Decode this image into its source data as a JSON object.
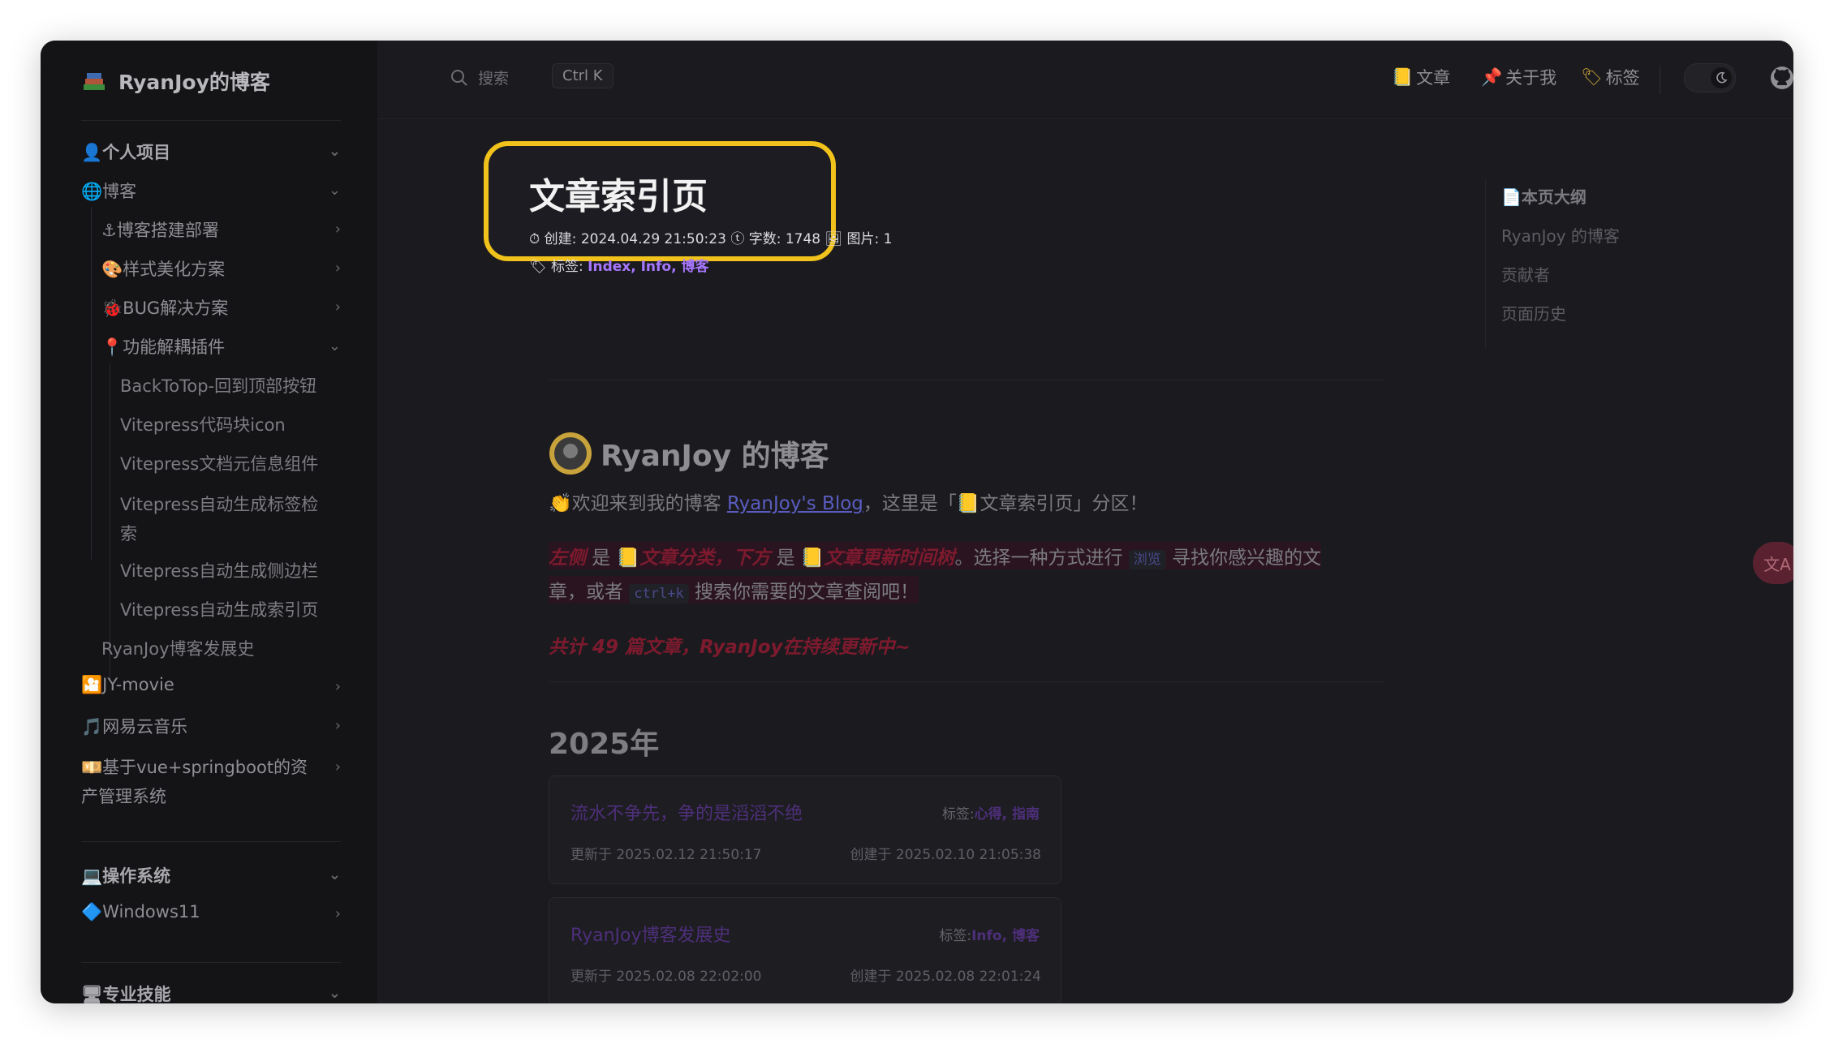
{
  "brand": {
    "title": "RyanJoy的博客"
  },
  "search": {
    "placeholder": "搜索",
    "shortcut": "Ctrl K"
  },
  "topnav": [
    {
      "label": "文章",
      "icon": "notebook-icon"
    },
    {
      "label": "关于我",
      "icon": "pin-icon"
    },
    {
      "label": "标签",
      "icon": "tag-icon"
    }
  ],
  "sidebar": {
    "sections": [
      {
        "label": "个人项目",
        "icon": "person-icon"
      },
      {
        "label": "博客",
        "icon": "globe-icon"
      },
      {
        "label": "博客搭建部署",
        "icon": "anchor-icon"
      },
      {
        "label": "样式美化方案",
        "icon": "palette-icon"
      },
      {
        "label": "BUG解决方案",
        "icon": "bug-icon"
      },
      {
        "label": "功能解耦插件",
        "icon": "pin-icon"
      },
      {
        "label": "BackToTop-回到顶部按钮"
      },
      {
        "label": "Vitepress代码块icon"
      },
      {
        "label": "Vitepress文档元信息组件"
      },
      {
        "label": "Vitepress自动生成标签检索"
      },
      {
        "label": "Vitepress自动生成侧边栏"
      },
      {
        "label": "Vitepress自动生成索引页"
      },
      {
        "label": "RyanJoy博客发展史"
      },
      {
        "label": "JY-movie",
        "icon": "film-icon"
      },
      {
        "label": "网易云音乐",
        "icon": "music-icon"
      },
      {
        "label": "基于vue+springboot的资产管理系统",
        "icon": "cash-icon"
      },
      {
        "label": "操作系统",
        "icon": "laptop-icon"
      },
      {
        "label": "Windows11",
        "icon": "diamond-icon"
      },
      {
        "label": "专业技能",
        "icon": "desktop-icon"
      }
    ]
  },
  "hero": {
    "title": "文章索引页",
    "created_label": "创建:",
    "created": "2024.04.29 21:50:23",
    "words_label": "字数:",
    "words": "1748",
    "images_label": "图片:",
    "images": "1",
    "tags_label": "标签:",
    "tags": "Index, Info, 博客"
  },
  "article": {
    "heading": "RyanJoy 的博客",
    "intro_pre": "欢迎来到我的博客 ",
    "intro_link": "RyanJoy's Blog",
    "intro_post": "，这里是「",
    "intro_section": "文章索引页",
    "intro_end": "」分区！",
    "p2_left": "左侧",
    "p2_is": " 是 ",
    "p2_cat": "文章分类",
    "p2_comma": "，",
    "p2_below": "下方",
    "p2_is2": " 是 ",
    "p2_tree": "文章更新时间树",
    "p2_rest": "。选择一种方式进行 ",
    "p2_code": "浏览",
    "p2_rest2": " 寻找你感兴趣的文",
    "p3_a": "章，或者 ",
    "p3_code": "ctrl+k",
    "p3_b": " 搜索你需要的文章查阅吧！",
    "total": "共计 49 篇文章，RyanJoy在持续更新中~",
    "year": "2025年"
  },
  "cards": [
    {
      "title": "流水不争先，争的是滔滔不绝",
      "tags_label": "标签:",
      "tags": "心得, 指南",
      "updated": "更新于 2025.02.12 21:50:17",
      "created": "创建于 2025.02.10 21:05:38"
    },
    {
      "title": "RyanJoy博客发展史",
      "tags_label": "标签:",
      "tags": "Info, 博客",
      "updated": "更新于 2025.02.08 22:02:00",
      "created": "创建于 2025.02.08 22:01:24"
    }
  ],
  "outline": {
    "title": "本页大纲",
    "items": [
      "RyanJoy 的博客",
      "贡献者",
      "页面历史"
    ]
  },
  "colors": {
    "accent_border": "#f1c21b",
    "tag_purple": "#a777ff",
    "bg_dark": "#1b1b1f",
    "sidebar_bg": "#141417"
  }
}
